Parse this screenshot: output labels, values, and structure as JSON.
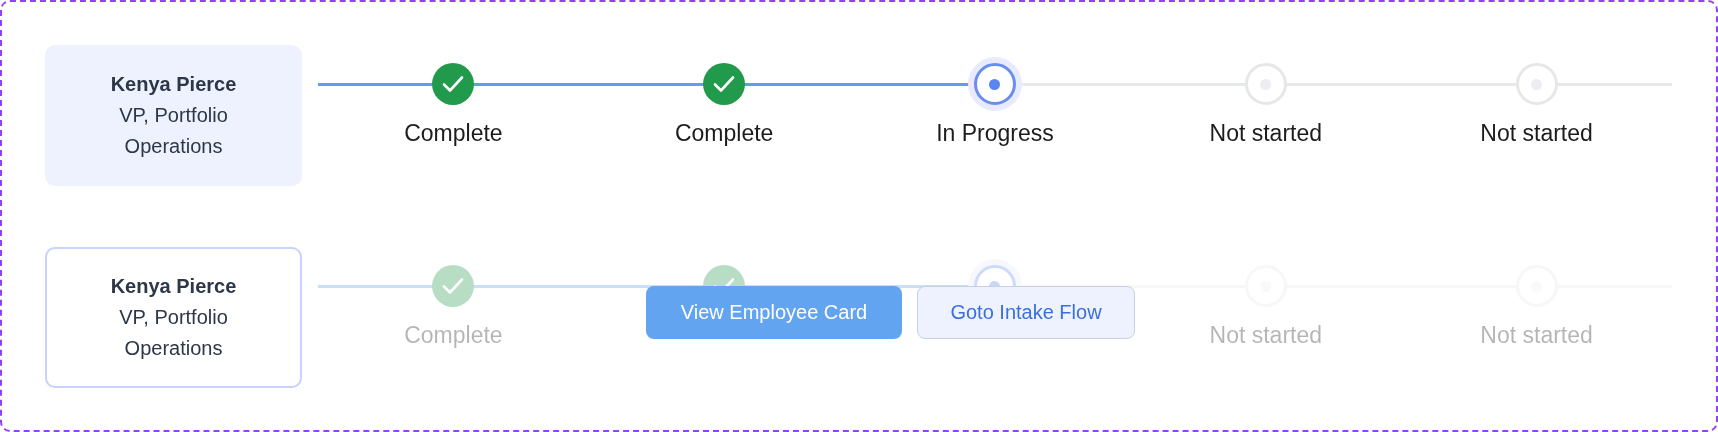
{
  "rows": [
    {
      "name": "Kenya Pierce",
      "title": "VP, Portfolio Operations",
      "hovered": false,
      "steps": [
        {
          "kind": "complete",
          "label": "Complete"
        },
        {
          "kind": "complete",
          "label": "Complete"
        },
        {
          "kind": "in_progress",
          "label": "In Progress"
        },
        {
          "kind": "not_started",
          "label": "Not started"
        },
        {
          "kind": "not_started",
          "label": "Not started"
        }
      ]
    },
    {
      "name": "Kenya Pierce",
      "title": "VP, Portfolio Operations",
      "hovered": true,
      "steps": [
        {
          "kind": "complete",
          "label": "Complete"
        },
        {
          "kind": "complete"
        },
        {
          "kind": "in_progress"
        },
        {
          "kind": "not_started",
          "label": "Not started"
        },
        {
          "kind": "not_started",
          "label": "Not started"
        }
      ],
      "actions": [
        {
          "kind": "primary",
          "label": "View Employee Card"
        },
        {
          "kind": "secondary",
          "label": "Goto Intake Flow"
        }
      ]
    }
  ]
}
